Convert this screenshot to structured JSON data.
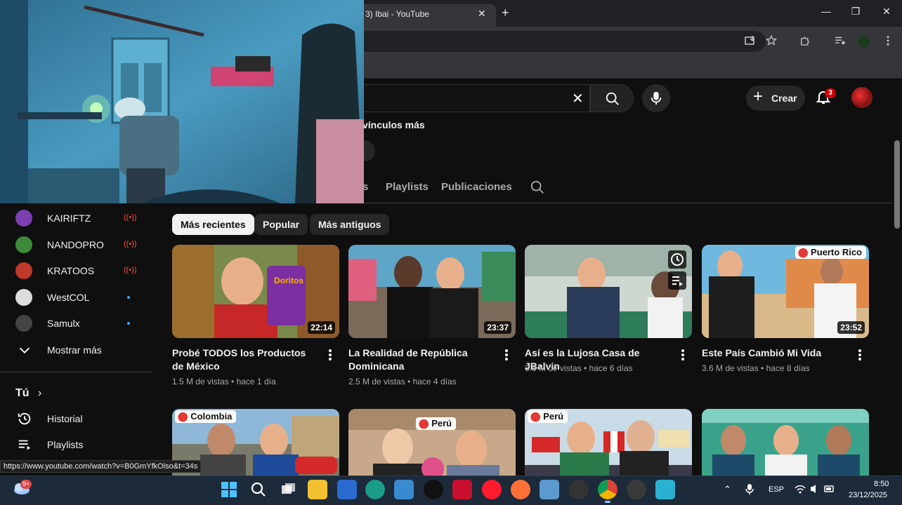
{
  "browser": {
    "tab_title": "3) Ibai - YouTube",
    "tab_close": "✕",
    "new_tab": "+",
    "window_controls": [
      "—",
      "❐",
      "✕"
    ]
  },
  "header": {
    "create_label": "Crear",
    "notification_count": "3"
  },
  "channel": {
    "links_text": "vínculos más",
    "tabs": [
      {
        "label": "s"
      },
      {
        "label": "Playlists"
      },
      {
        "label": "Publicaciones"
      }
    ]
  },
  "sidebar": {
    "subscriptions": [
      {
        "name": "KAIRIFTZ",
        "status": "live",
        "live_icon": "((•))",
        "color": "#7b3fb0"
      },
      {
        "name": "NANDOPRO",
        "status": "live",
        "live_icon": "((•))",
        "color": "#3d8a3a"
      },
      {
        "name": "KRATOOS",
        "status": "live",
        "live_icon": "((•))",
        "color": "#c0392b"
      },
      {
        "name": "WestCOL",
        "status": "new",
        "color": "#dddddd"
      },
      {
        "name": "Samulx",
        "status": "new",
        "color": "#444444"
      }
    ],
    "show_more": "Mostrar más",
    "you_section": "Tú",
    "you_chevron": "›",
    "history": "Historial",
    "playlists": "Playlists"
  },
  "chips": [
    "Más recientes",
    "Popular",
    "Más antiguos"
  ],
  "videos": [
    {
      "title": "Probé TODOS los Productos de México",
      "views": "1.5 M de vistas",
      "age": "hace 1 día",
      "duration": "22:14",
      "location": ""
    },
    {
      "title": "La Realidad de República Dominicana",
      "views": "2.5 M de vistas",
      "age": "hace 4 días",
      "duration": "23:37",
      "location": ""
    },
    {
      "title": "Así es la Lujosa Casa de JBalvin",
      "views": "3.8 M de vistas",
      "age": "hace 6 días",
      "duration": "",
      "location": ""
    },
    {
      "title": "Este País Cambió Mi Vida",
      "views": "3.6 M de vistas",
      "age": "hace 8 días",
      "duration": "23:52",
      "location": "Puerto Rico"
    },
    {
      "title": "",
      "views": "",
      "age": "",
      "duration": "",
      "location": "Colombia"
    },
    {
      "title": "",
      "views": "",
      "age": "",
      "duration": "",
      "location": "Perú"
    },
    {
      "title": "",
      "views": "",
      "age": "",
      "duration": "",
      "location": "Perú"
    },
    {
      "title": "",
      "views": "",
      "age": "",
      "duration": "",
      "location": ""
    }
  ],
  "status_url": "https://www.youtube.com/watch?v=B0GmYfkOlso&t=34s",
  "taskbar": {
    "weather_badge": "9+",
    "language": "ESP",
    "time": "8:50",
    "date": "23/12/2025"
  }
}
